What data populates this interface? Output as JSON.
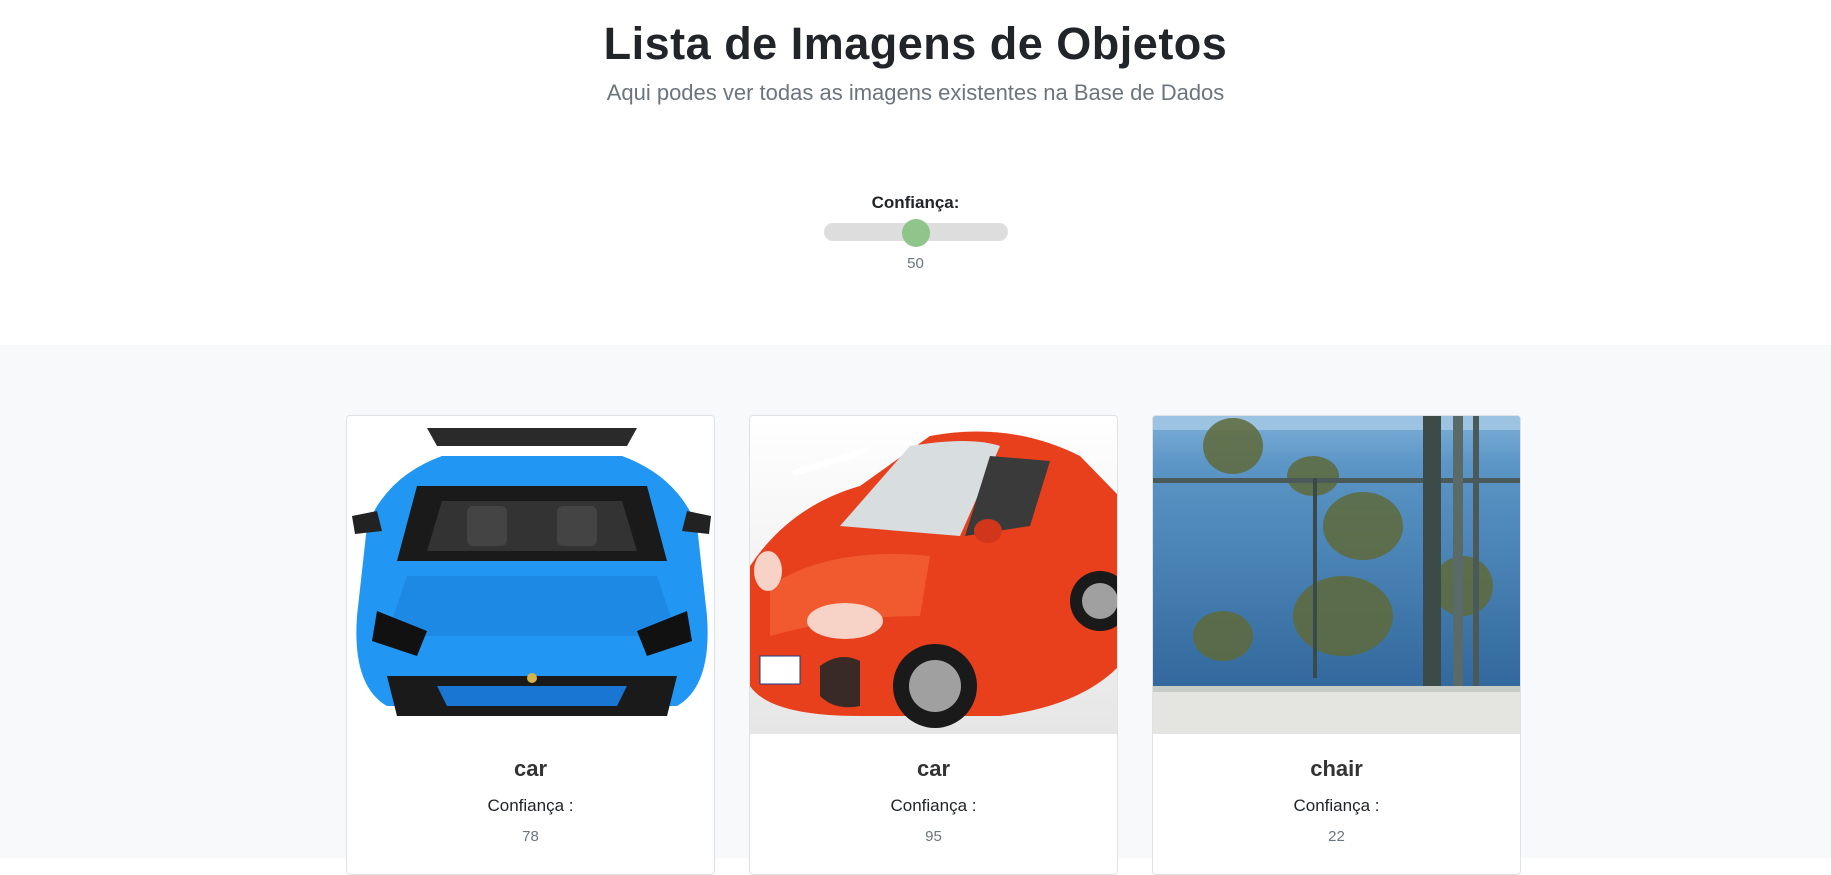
{
  "header": {
    "title": "Lista de Imagens de Objetos",
    "subtitle": "Aqui podes ver todas as imagens existentes na Base de Dados"
  },
  "filter": {
    "label": "Confiança:",
    "value": "50",
    "level": 0.5,
    "accent_color": "#8fc48a"
  },
  "cards": [
    {
      "title": "car",
      "label": "Confiança :",
      "value": "78",
      "image": "blue-sports-car"
    },
    {
      "title": "car",
      "label": "Confiança :",
      "value": "95",
      "image": "red-sports-car"
    },
    {
      "title": "chair",
      "label": "Confiança :",
      "value": "22",
      "image": "balcony-sea-view"
    }
  ]
}
